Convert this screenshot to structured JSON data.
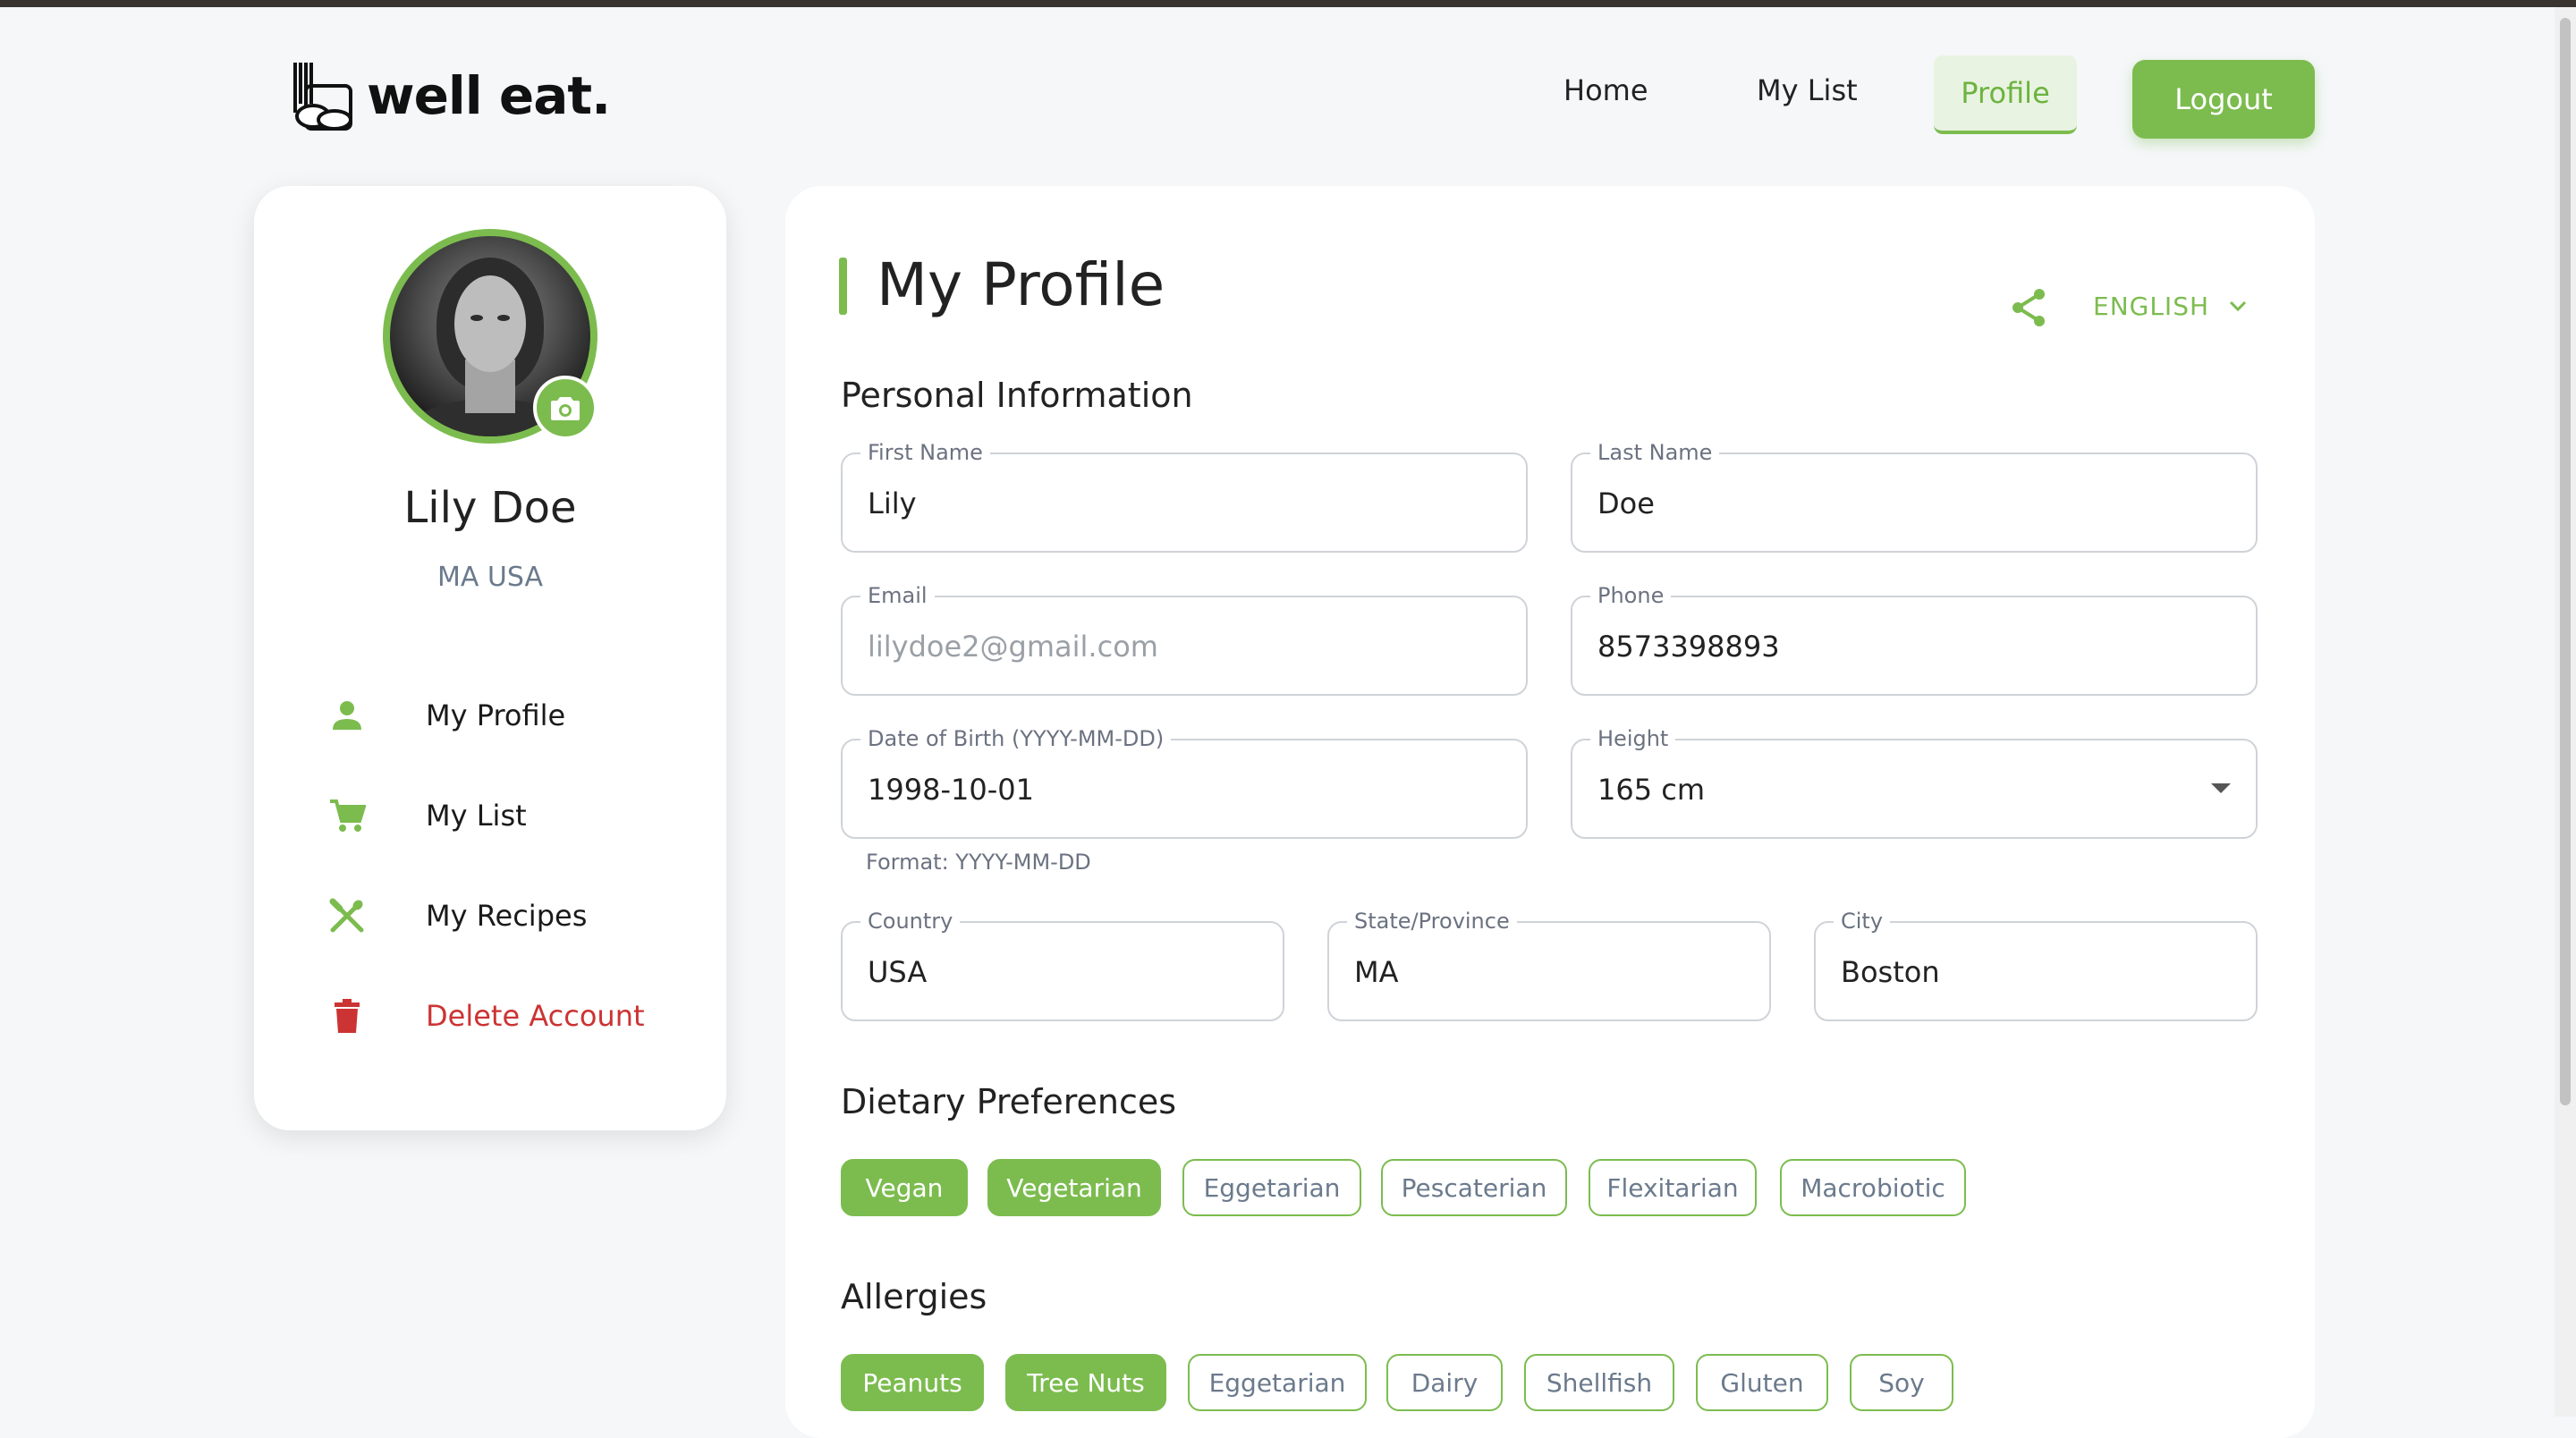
{
  "header": {
    "brand": "well eat.",
    "nav": {
      "home": "Home",
      "my_list": "My List",
      "profile": "Profile"
    },
    "logout": "Logout"
  },
  "sidebar": {
    "name": "Lily Doe",
    "location": "MA USA",
    "items": [
      {
        "label": "My Profile",
        "icon": "person-icon"
      },
      {
        "label": "My List",
        "icon": "cart-icon"
      },
      {
        "label": "My Recipes",
        "icon": "utensils-icon"
      },
      {
        "label": "Delete Account",
        "icon": "trash-icon"
      }
    ]
  },
  "main": {
    "title": "My Profile",
    "language": "ENGLISH",
    "personal_section": "Personal Information",
    "fields": {
      "first_name": {
        "label": "First Name",
        "value": "Lily"
      },
      "last_name": {
        "label": "Last Name",
        "value": "Doe"
      },
      "email": {
        "label": "Email",
        "value": "lilydoe2@gmail.com"
      },
      "phone": {
        "label": "Phone",
        "value": "8573398893"
      },
      "dob": {
        "label": "Date of Birth (YYYY-MM-DD)",
        "value": "1998-10-01",
        "helper": "Format: YYYY-MM-DD"
      },
      "height": {
        "label": "Height",
        "value": "165 cm"
      },
      "country": {
        "label": "Country",
        "value": "USA"
      },
      "state": {
        "label": "State/Province",
        "value": "MA"
      },
      "city": {
        "label": "City",
        "value": "Boston"
      }
    },
    "dietary_section": "Dietary Preferences",
    "dietary": [
      {
        "label": "Vegan",
        "selected": true
      },
      {
        "label": "Vegetarian",
        "selected": true
      },
      {
        "label": "Eggetarian",
        "selected": false
      },
      {
        "label": "Pescaterian",
        "selected": false
      },
      {
        "label": "Flexitarian",
        "selected": false
      },
      {
        "label": "Macrobiotic",
        "selected": false
      }
    ],
    "allergies_section": "Allergies",
    "allergies": [
      {
        "label": "Peanuts",
        "selected": true
      },
      {
        "label": "Tree Nuts",
        "selected": true
      },
      {
        "label": "Eggetarian",
        "selected": false
      },
      {
        "label": "Dairy",
        "selected": false
      },
      {
        "label": "Shellfish",
        "selected": false
      },
      {
        "label": "Gluten",
        "selected": false
      },
      {
        "label": "Soy",
        "selected": false
      }
    ]
  },
  "colors": {
    "accent": "#7cbc4f",
    "danger": "#cc3333",
    "muted_text": "#6b7a8c"
  }
}
